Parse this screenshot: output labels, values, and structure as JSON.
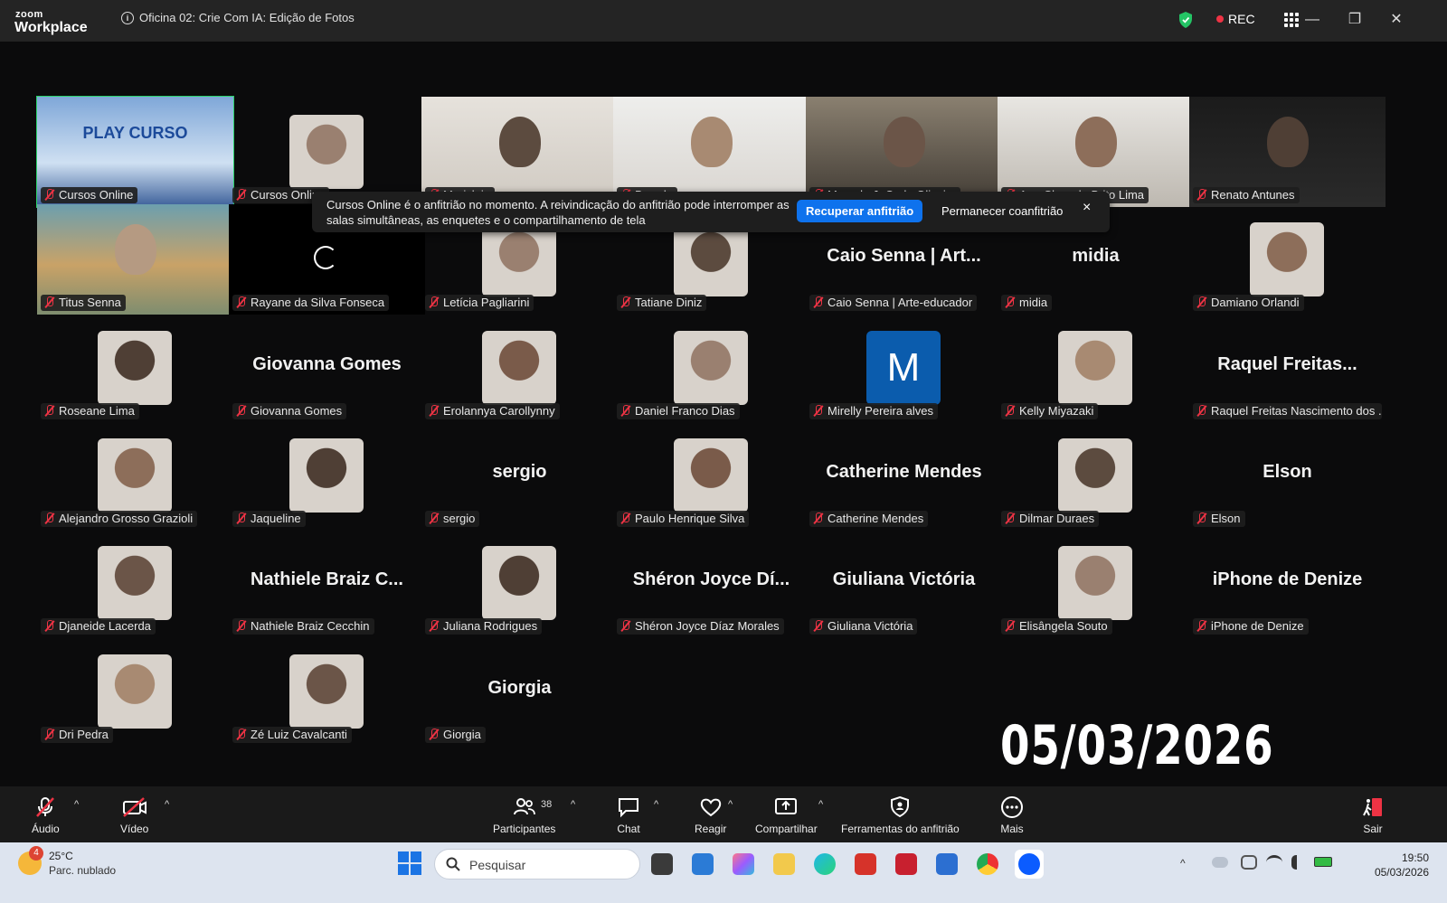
{
  "window": {
    "logo_top": "zoom",
    "logo_bottom": "Workplace",
    "meeting_title": "Oficina 02: Crie Com IA: Edição de Fotos",
    "rec_label": "REC"
  },
  "banner": {
    "message": "Cursos Online é o anfitrião no momento. A reivindicação do anfitrião pode interromper as salas simultâneas, as enquetes e o compartilhamento de tela",
    "primary_button": "Recuperar anfitrião",
    "secondary_button": "Permanecer coanfitrião",
    "close": "×"
  },
  "participants": [
    {
      "name": "Cursos Online",
      "type": "video",
      "active": true,
      "overlay": "PLAY CURSO"
    },
    {
      "name": "Cursos Online",
      "type": "photo"
    },
    {
      "name": "Marisleia",
      "type": "video"
    },
    {
      "name": "Brenda",
      "type": "video"
    },
    {
      "name": "Marcelo J. C. de Oliveira",
      "type": "video"
    },
    {
      "name": "Ana Clara de Brito Lima",
      "type": "video"
    },
    {
      "name": "Renato Antunes",
      "type": "video"
    },
    {
      "name": "Titus Senna",
      "type": "video"
    },
    {
      "name": "Rayane da Silva Fonseca",
      "type": "loading"
    },
    {
      "name": "Letícia Pagliarini",
      "type": "photo"
    },
    {
      "name": "Tatiane Diniz",
      "type": "photo"
    },
    {
      "name": "Caio Senna | Arte-educador",
      "type": "text",
      "display": "Caio Senna | Art..."
    },
    {
      "name": "midia",
      "type": "text",
      "display": "midia"
    },
    {
      "name": "Damiano Orlandi",
      "type": "photo"
    },
    {
      "name": "Roseane Lima",
      "type": "photo"
    },
    {
      "name": "Giovanna Gomes",
      "type": "text",
      "display": "Giovanna Gomes"
    },
    {
      "name": "Erolannya Carollynny",
      "type": "photo"
    },
    {
      "name": "Daniel Franco Dias",
      "type": "photo"
    },
    {
      "name": "Mirelly Pereira alves",
      "type": "letter",
      "letter": "M"
    },
    {
      "name": "Kelly Miyazaki",
      "type": "photo"
    },
    {
      "name": "Raquel Freitas Nascimento dos ...",
      "type": "text",
      "display": "Raquel  Freitas..."
    },
    {
      "name": "Alejandro Grosso Grazioli",
      "type": "photo"
    },
    {
      "name": "Jaqueline",
      "type": "photo"
    },
    {
      "name": "sergio",
      "type": "text",
      "display": "sergio"
    },
    {
      "name": "Paulo Henrique Silva",
      "type": "photo"
    },
    {
      "name": "Catherine Mendes",
      "type": "text",
      "display": "Catherine Mendes"
    },
    {
      "name": "Dilmar Duraes",
      "type": "photo"
    },
    {
      "name": "Elson",
      "type": "text",
      "display": "Elson"
    },
    {
      "name": "Djaneide Lacerda",
      "type": "photo"
    },
    {
      "name": "Nathiele Braiz Cecchin",
      "type": "text",
      "display": "Nathiele  Braiz  C..."
    },
    {
      "name": "Juliana Rodrigues",
      "type": "photo"
    },
    {
      "name": "Shéron Joyce Díaz Morales",
      "type": "text",
      "display": "Shéron  Joyce  Dí..."
    },
    {
      "name": "Giuliana Victória",
      "type": "text",
      "display": "Giuliana Victória"
    },
    {
      "name": "Elisângela Souto",
      "type": "photo"
    },
    {
      "name": "iPhone de Denize",
      "type": "text",
      "display": "iPhone de Denize"
    },
    {
      "name": "Dri Pedra",
      "type": "photo"
    },
    {
      "name": "Zé Luiz Cavalcanti",
      "type": "photo"
    },
    {
      "name": "Giorgia",
      "type": "text",
      "display": "Giorgia"
    }
  ],
  "timestamp_overlay": "05/03/2026 19:50",
  "toolbar": {
    "audio": "Áudio",
    "video": "Vídeo",
    "participants": "Participantes",
    "participants_count": "38",
    "chat": "Chat",
    "react": "Reagir",
    "share": "Compartilhar",
    "host_tools": "Ferramentas do anfitrião",
    "more": "Mais",
    "leave": "Sair"
  },
  "taskbar": {
    "weather_badge": "4",
    "temperature": "25°C",
    "condition": "Parc. nublado",
    "search_placeholder": "Pesquisar",
    "time": "19:50",
    "date": "05/03/2026"
  }
}
